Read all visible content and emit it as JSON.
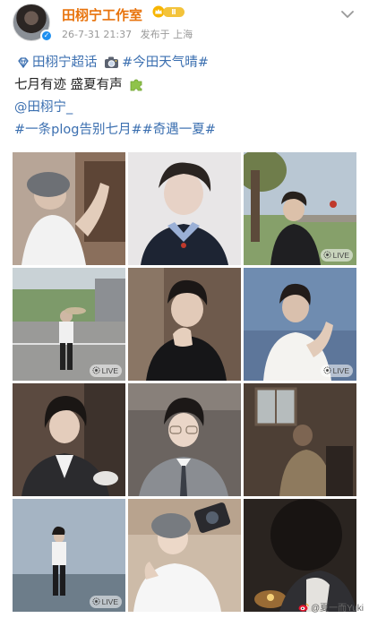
{
  "post": {
    "author": "田栩宁工作室",
    "level_badge": "Ⅱ",
    "timestamp": "26-7-31 21:37",
    "location": "发布于 上海",
    "lines": {
      "line1_tag1": "田栩宁超话",
      "line1_tag2": "#今田天气晴#",
      "line2": "七月有迹 盛夏有声",
      "line3_mention": "@田栩宁_",
      "line4_tags": "#一条plog告别七月##奇遇一夏#"
    }
  },
  "photos": [
    {
      "live": false,
      "desc": "grey beanie, white t-shirt, arm raised"
    },
    {
      "live": false,
      "desc": "navy sweater over plaid collar"
    },
    {
      "live": true,
      "desc": "outdoors under tree, black shirt",
      "live_label": "LIVE"
    },
    {
      "live": true,
      "desc": "full body on road holding board",
      "live_label": "LIVE"
    },
    {
      "live": false,
      "desc": "black jacket, hand near face"
    },
    {
      "live": true,
      "desc": "white shirt, dusk sky",
      "live_label": "LIVE"
    },
    {
      "live": false,
      "desc": "white shirt, dark suit jacket"
    },
    {
      "live": false,
      "desc": "glasses, grey suit, tie"
    },
    {
      "live": false,
      "desc": "dim room by window"
    },
    {
      "live": true,
      "desc": "standing by water at night",
      "live_label": "LIVE"
    },
    {
      "live": false,
      "desc": "beanie, white tee, holding camera"
    },
    {
      "live": false,
      "desc": "dark silhouette, warm light"
    }
  ],
  "watermark": "@夏一而Yuki",
  "colors": {
    "username": "#e8730c",
    "link": "#3b6fb0",
    "meta": "#999999",
    "verified": "#1e8ff0",
    "level": "#f3c33b"
  }
}
